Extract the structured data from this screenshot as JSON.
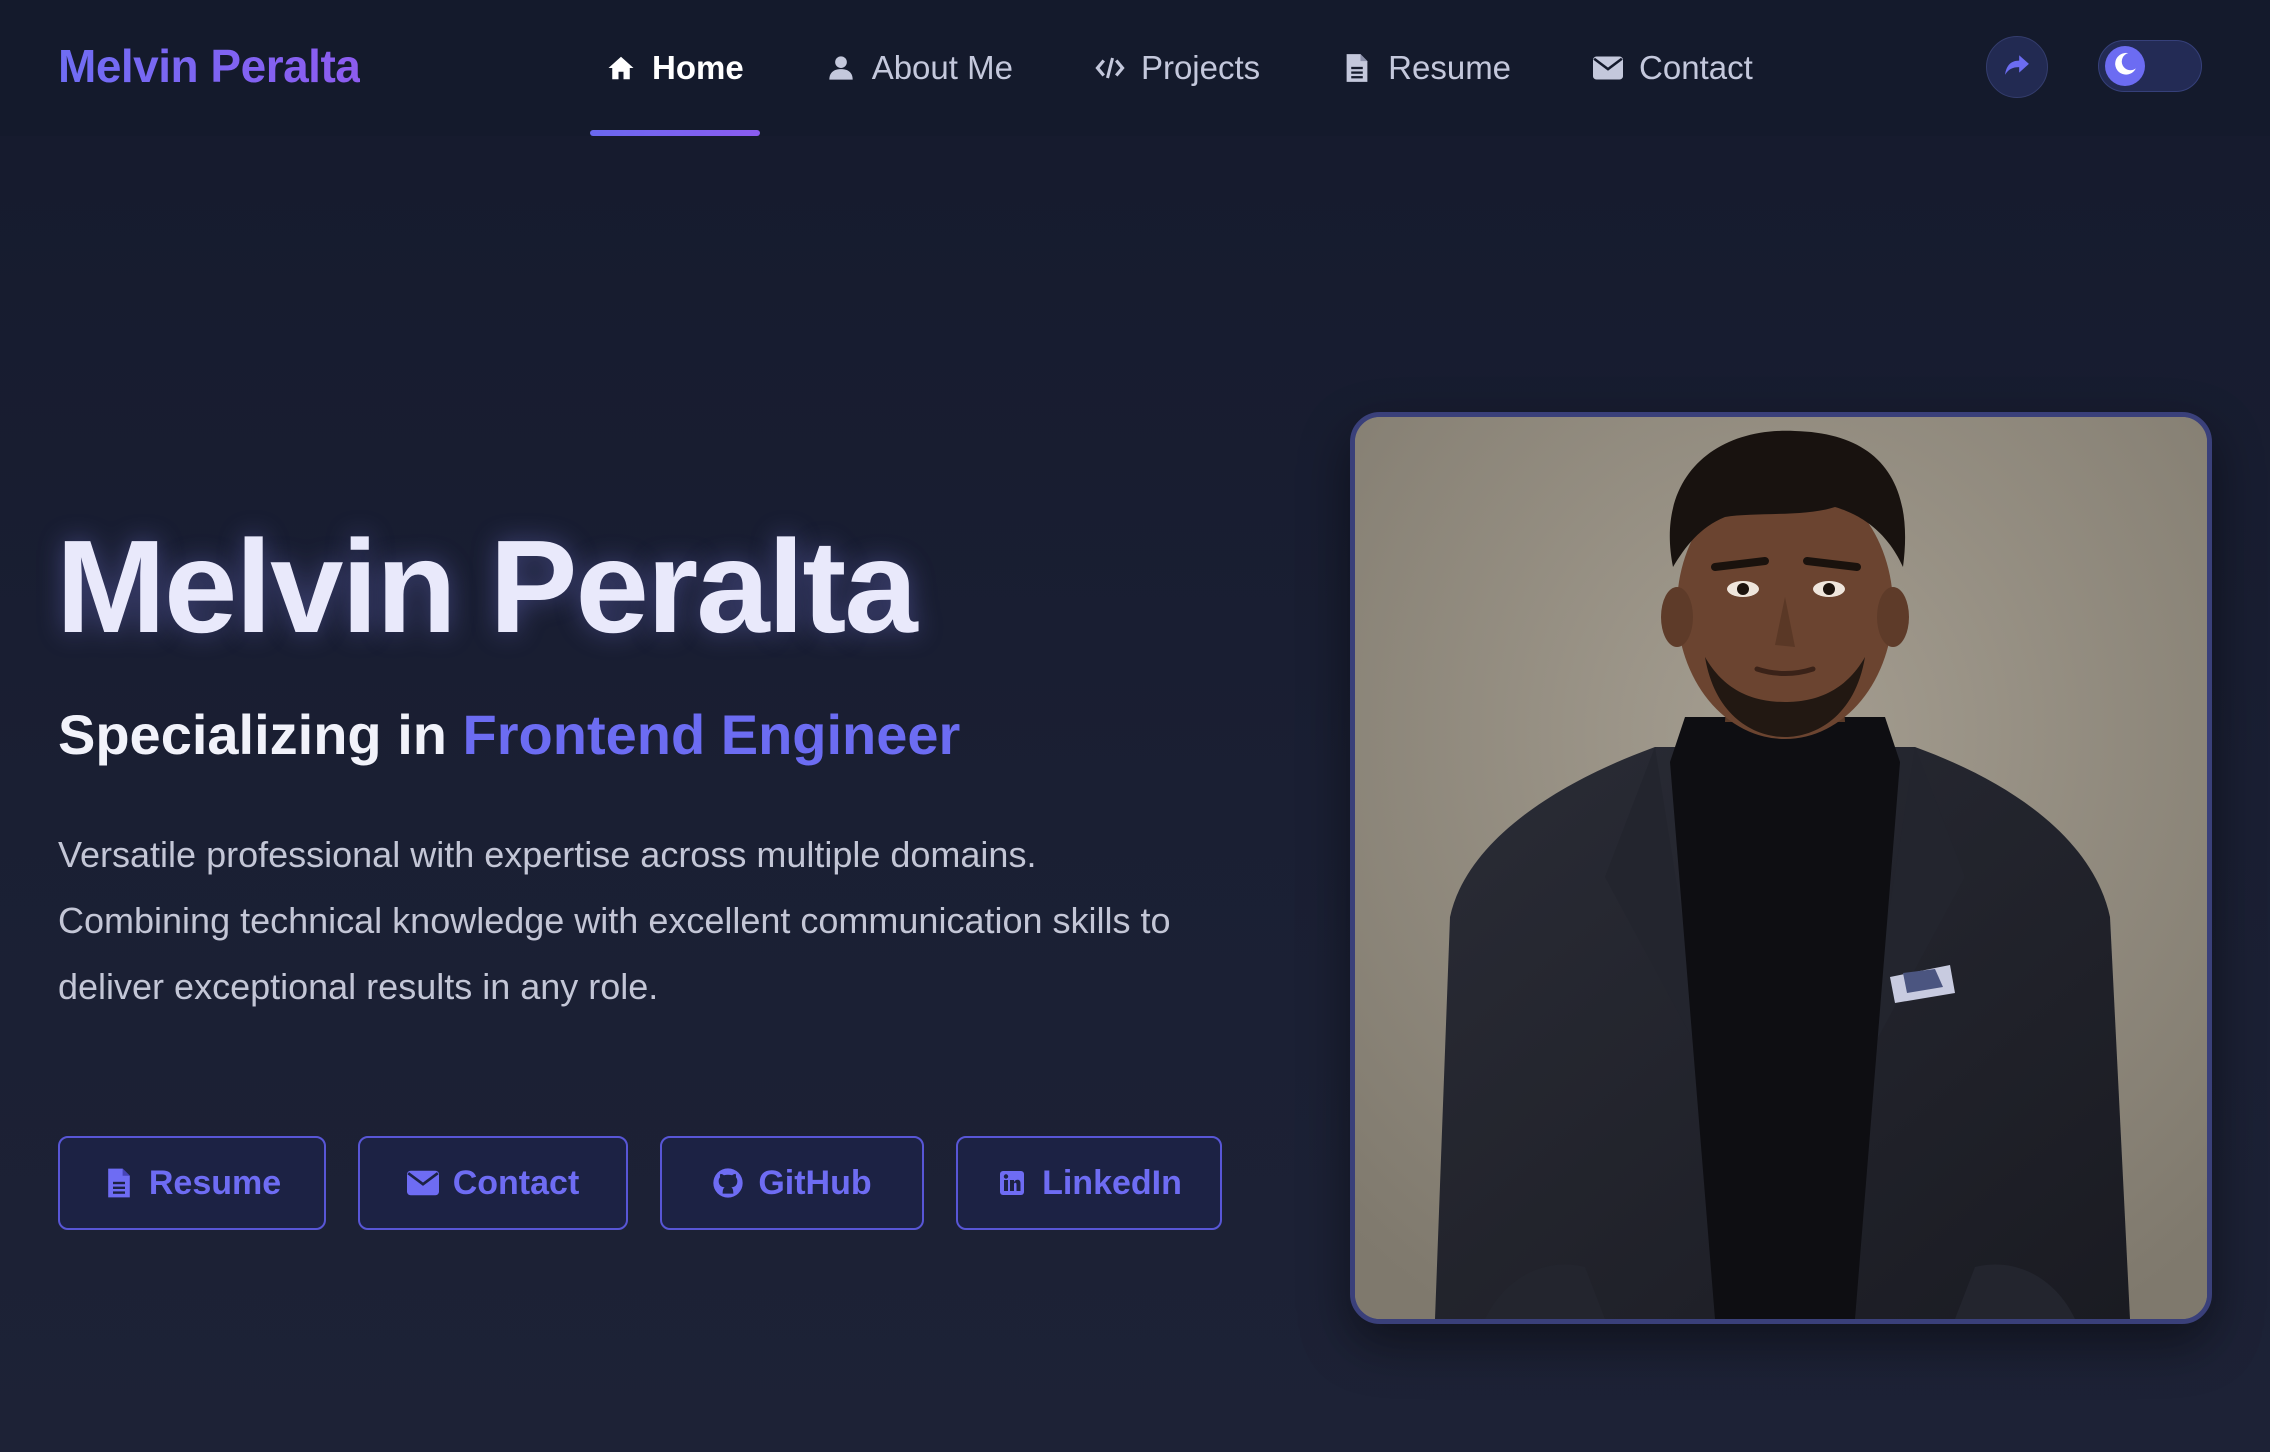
{
  "brand": {
    "name": "Melvin Peralta"
  },
  "nav": {
    "items": [
      {
        "label": "Home",
        "icon": "home-icon",
        "active": true
      },
      {
        "label": "About Me",
        "icon": "user-icon",
        "active": false
      },
      {
        "label": "Projects",
        "icon": "code-icon",
        "active": false
      },
      {
        "label": "Resume",
        "icon": "file-icon",
        "active": false
      },
      {
        "label": "Contact",
        "icon": "envelope-icon",
        "active": false
      }
    ],
    "share_icon": "share-icon",
    "theme_toggle": {
      "icon": "moon-icon",
      "mode": "dark"
    }
  },
  "hero": {
    "title": "Melvin Peralta",
    "subtitle_prefix": "Specializing in",
    "subtitle_role": "Frontend Engineer",
    "description_lines": [
      "Versatile professional with expertise across multiple domains.",
      "Combining technical knowledge with excellent communication skills to",
      "deliver exceptional results in any role."
    ],
    "buttons": [
      {
        "label": "Resume",
        "icon": "file-icon"
      },
      {
        "label": "Contact",
        "icon": "envelope-icon"
      },
      {
        "label": "GitHub",
        "icon": "github-icon"
      },
      {
        "label": "LinkedIn",
        "icon": "linkedin-icon"
      }
    ]
  },
  "portrait": {
    "subject": "profile-photo"
  },
  "colors": {
    "background": "#151a2d",
    "navbar": "#141a2c",
    "accent": "#6c6cf2",
    "accent_purple": "#8d5cf0",
    "button_border": "#5856d6",
    "text_primary": "#e9e9fb",
    "text_muted": "#c3c6d6"
  }
}
